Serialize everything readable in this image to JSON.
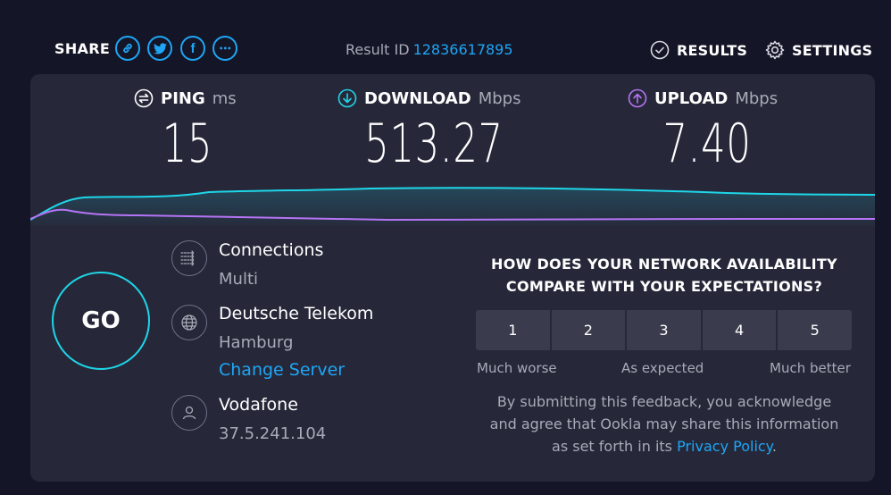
{
  "share": {
    "label": "SHARE",
    "buttons": [
      {
        "name": "link",
        "icon": "link-icon"
      },
      {
        "name": "twitter",
        "icon": "twitter-icon"
      },
      {
        "name": "facebook",
        "icon": "facebook-icon",
        "glyph": "f"
      },
      {
        "name": "more",
        "icon": "more-icon",
        "glyph": "•••"
      }
    ]
  },
  "result": {
    "label": "Result ID",
    "id": "12836617895"
  },
  "nav": {
    "results": "RESULTS",
    "settings": "SETTINGS"
  },
  "metrics": {
    "ping": {
      "label": "PING",
      "unit": "ms",
      "value": "15",
      "icon": "ping-icon",
      "color": "#ffffff"
    },
    "download": {
      "label": "DOWNLOAD",
      "unit": "Mbps",
      "value": "513.27",
      "icon": "download-icon",
      "color": "#1ed6e8"
    },
    "upload": {
      "label": "UPLOAD",
      "unit": "Mbps",
      "value": "7.40",
      "icon": "upload-icon",
      "color": "#b574f5"
    }
  },
  "go": {
    "label": "GO"
  },
  "connections": {
    "title": "Connections",
    "value": "Multi",
    "icon": "connections-icon"
  },
  "server": {
    "title": "Deutsche Telekom",
    "location": "Hamburg",
    "change_label": "Change Server",
    "icon": "globe-icon"
  },
  "provider": {
    "title": "Vodafone",
    "ip": "37.5.241.104",
    "icon": "user-icon"
  },
  "survey": {
    "question_line1": "HOW DOES YOUR NETWORK AVAILABILITY",
    "question_line2": "COMPARE WITH YOUR EXPECTATIONS?",
    "options": [
      "1",
      "2",
      "3",
      "4",
      "5"
    ],
    "low_label": "Much worse",
    "mid_label": "As expected",
    "high_label": "Much better",
    "disclaimer_line1": "By submitting this feedback, you acknowledge",
    "disclaimer_line2": "and agree that Ookla may share this information",
    "disclaimer_line3": "as set forth in its",
    "privacy_link": "Privacy Policy",
    "disclaimer_end": "."
  },
  "colors": {
    "background": "#141526",
    "panel": "#262839",
    "accent_blue": "#1ea6f5",
    "download_cyan": "#1ed6e8",
    "upload_purple": "#b574f5",
    "muted_text": "#a9aab8"
  }
}
